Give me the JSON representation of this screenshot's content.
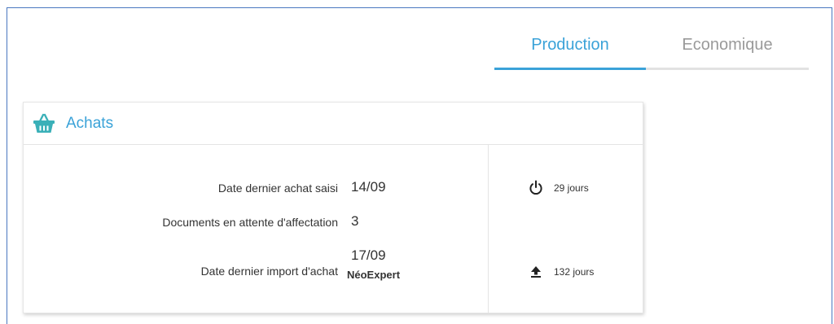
{
  "tabs": [
    {
      "label": "Production",
      "active": true
    },
    {
      "label": "Economique",
      "active": false
    }
  ],
  "colors": {
    "accent": "#3aa2d8",
    "inactive_tab": "#9a9a9a",
    "basket_icon": "#3ab0b8",
    "frame_border": "#4a78c0"
  },
  "card": {
    "title": "Achats",
    "icon": "basket-icon",
    "rows": [
      {
        "label": "Date dernier achat saisi",
        "value": "14/09"
      },
      {
        "label": "Documents en attente d'affectation",
        "value": "3"
      },
      {
        "label": "Date dernier import d'achat",
        "value": "17/09",
        "sub_value": "NéoExpert"
      }
    ],
    "side_stats": [
      {
        "icon": "power-icon",
        "text": "29 jours"
      },
      {
        "icon": "upload-icon",
        "text": "132 jours"
      }
    ]
  }
}
